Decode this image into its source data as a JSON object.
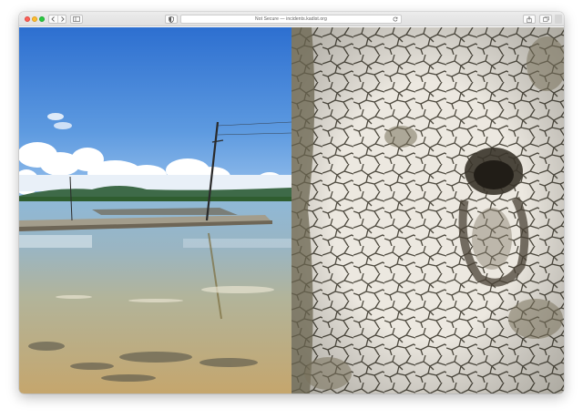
{
  "window": {
    "address": "Not Secure — incidents.kadist.org"
  },
  "icons": {
    "close": "close-traffic-light",
    "minimize": "minimize-traffic-light",
    "zoom": "zoom-traffic-light",
    "back": "chevron-left-icon",
    "forward": "chevron-right-icon",
    "sidebar": "sidebar-icon",
    "privacy": "shield-icon",
    "reload": "reload-icon",
    "share": "share-icon",
    "tabs": "tabs-icon"
  },
  "colors": {
    "close": "#fc5f57",
    "minimize": "#fdbc2e",
    "zoom": "#28c840",
    "toolbar": "#e6e6e6"
  },
  "content": {
    "images": [
      {
        "subject": "salt flats landscape with utility pole and blue sky"
      },
      {
        "subject": "close-up of cracked dry white salt crust with a footprint"
      }
    ]
  }
}
